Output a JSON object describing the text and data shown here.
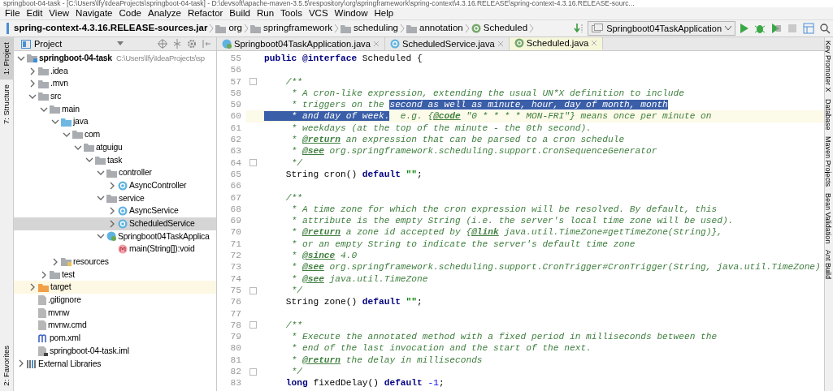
{
  "window": {
    "title": "springboot-04-task - [C:\\Users\\lfy\\IdeaProjects\\springboot-04-task] - D:\\devsoft\\apache-maven-3.5.5\\respository\\org\\springframework\\spring-context\\4.3.16.RELEASE\\spring-context-4.3.16.RELEASE-sourc..."
  },
  "menu": [
    "File",
    "Edit",
    "View",
    "Navigate",
    "Code",
    "Analyze",
    "Refactor",
    "Build",
    "Run",
    "Tools",
    "VCS",
    "Window",
    "Help"
  ],
  "breadcrumbs": [
    {
      "label": "spring-context-4.3.16.RELEASE-sources.jar",
      "kind": "jar"
    },
    {
      "label": "org",
      "kind": "folder"
    },
    {
      "label": "springframework",
      "kind": "folder"
    },
    {
      "label": "scheduling",
      "kind": "folder"
    },
    {
      "label": "annotation",
      "kind": "folder"
    },
    {
      "label": "Scheduled",
      "kind": "annotation"
    }
  ],
  "run_config": "Springboot04TaskApplication",
  "left_tabs": [
    {
      "label": "1: Project",
      "selected": true
    },
    {
      "label": "7: Structure",
      "selected": false
    },
    {
      "label": "2: Favorites",
      "selected": false
    }
  ],
  "right_tabs": [
    "Key Promoter X",
    "Database",
    "Maven Projects",
    "Bean Validation",
    "Ant Build"
  ],
  "project_panel": {
    "title": "Project",
    "tree": [
      {
        "label": "springboot-04-task",
        "hint": "C:\\Users\\lfy\\IdeaProjects\\sp",
        "kind": "project",
        "expanded": true,
        "selected": false,
        "children": [
          {
            "label": ".idea",
            "kind": "folder",
            "expanded": false,
            "selected": false
          },
          {
            "label": ".mvn",
            "kind": "folder",
            "expanded": false,
            "selected": false
          },
          {
            "label": "src",
            "kind": "folder",
            "expanded": true,
            "selected": false,
            "children": [
              {
                "label": "main",
                "kind": "folder",
                "expanded": true,
                "selected": false,
                "children": [
                  {
                    "label": "java",
                    "kind": "source-folder",
                    "expanded": true,
                    "selected": false,
                    "children": [
                      {
                        "label": "com",
                        "kind": "package",
                        "expanded": true,
                        "selected": false,
                        "children": [
                          {
                            "label": "atguigu",
                            "kind": "package",
                            "expanded": true,
                            "selected": false,
                            "children": [
                              {
                                "label": "task",
                                "kind": "package",
                                "expanded": true,
                                "selected": false,
                                "children": [
                                  {
                                    "label": "controller",
                                    "kind": "package",
                                    "expanded": true,
                                    "selected": false,
                                    "children": [
                                      {
                                        "label": "AsyncController",
                                        "kind": "class",
                                        "expanded": false,
                                        "selected": false
                                      }
                                    ]
                                  },
                                  {
                                    "label": "service",
                                    "kind": "package",
                                    "expanded": true,
                                    "selected": false,
                                    "children": [
                                      {
                                        "label": "AsyncService",
                                        "kind": "class",
                                        "expanded": false,
                                        "selected": false
                                      },
                                      {
                                        "label": "ScheduledService",
                                        "kind": "class",
                                        "expanded": false,
                                        "selected": true
                                      }
                                    ]
                                  },
                                  {
                                    "label": "Springboot04TaskApplica",
                                    "kind": "spring-class",
                                    "expanded": true,
                                    "selected": false,
                                    "children": [
                                      {
                                        "label": "main(String[]):void",
                                        "kind": "method",
                                        "selected": false
                                      }
                                    ]
                                  }
                                ]
                              }
                            ]
                          }
                        ]
                      }
                    ]
                  },
                  {
                    "label": "resources",
                    "kind": "resources-folder",
                    "expanded": false,
                    "selected": false
                  }
                ]
              },
              {
                "label": "test",
                "kind": "folder",
                "expanded": false,
                "selected": false
              }
            ]
          },
          {
            "label": "target",
            "kind": "excluded-folder",
            "expanded": false,
            "selected": false
          },
          {
            "label": ".gitignore",
            "kind": "file",
            "selected": false
          },
          {
            "label": "mvnw",
            "kind": "file",
            "selected": false
          },
          {
            "label": "mvnw.cmd",
            "kind": "file",
            "selected": false
          },
          {
            "label": "pom.xml",
            "kind": "maven",
            "selected": false
          },
          {
            "label": "springboot-04-task.iml",
            "kind": "iml",
            "selected": false
          }
        ]
      },
      {
        "label": "External Libraries",
        "kind": "libraries",
        "expanded": false,
        "selected": false
      }
    ]
  },
  "editor_tabs": [
    {
      "label": "Springboot04TaskApplication.java",
      "kind": "spring-class",
      "selected": false
    },
    {
      "label": "ScheduledService.java",
      "kind": "class",
      "selected": false
    },
    {
      "label": "Scheduled.java",
      "kind": "annotation",
      "selected": true
    }
  ],
  "code": [
    {
      "n": "55",
      "segments": [
        {
          "text": "public @interface",
          "kind": "keyword"
        },
        {
          "text": " Scheduled {",
          "kind": "plain"
        }
      ]
    },
    {
      "n": "56"
    },
    {
      "n": "57",
      "fold": true,
      "segments": [
        {
          "text": "    /**",
          "kind": "comment"
        }
      ]
    },
    {
      "n": "58",
      "segments": [
        {
          "text": "     * A cron-like expression, extending the usual UN*X definition to include",
          "kind": "comment"
        }
      ]
    },
    {
      "n": "59",
      "segments": [
        {
          "text": "     * triggers on the ",
          "kind": "comment",
          "selected": false
        },
        {
          "text": "second as well as minute, hour, day of month, month",
          "kind": "comment",
          "selected": true
        }
      ]
    },
    {
      "n": "60",
      "current": true,
      "segments": [
        {
          "text": "     * and day of week.",
          "kind": "comment",
          "selected": true
        },
        {
          "text": "  e.g. {",
          "kind": "comment",
          "selected": false
        },
        {
          "text": "@code",
          "kind": "doctag",
          "selected": false
        },
        {
          "text": " \"0 * * * * MON-FRI\"} means once per minute on",
          "kind": "comment",
          "selected": false
        }
      ]
    },
    {
      "n": "61",
      "segments": [
        {
          "text": "     * weekdays (at the top of the minute - the 0th second).",
          "kind": "comment"
        }
      ]
    },
    {
      "n": "62",
      "segments": [
        {
          "text": "     * ",
          "kind": "comment"
        },
        {
          "text": "@return",
          "kind": "doctag"
        },
        {
          "text": " an expression that can be parsed to a cron schedule",
          "kind": "comment"
        }
      ]
    },
    {
      "n": "63",
      "segments": [
        {
          "text": "     * ",
          "kind": "comment"
        },
        {
          "text": "@see",
          "kind": "doctag"
        },
        {
          "text": " org.springframework.scheduling.support.CronSequenceGenerator",
          "kind": "comment"
        }
      ]
    },
    {
      "n": "64",
      "fold": true,
      "segments": [
        {
          "text": "     */",
          "kind": "comment"
        }
      ]
    },
    {
      "n": "65",
      "segments": [
        {
          "text": "    String cron() ",
          "kind": "plain"
        },
        {
          "text": "default",
          "kind": "keyword"
        },
        {
          "text": " \"\"",
          "kind": "string"
        },
        {
          "text": ";",
          "kind": "plain"
        }
      ]
    },
    {
      "n": "66"
    },
    {
      "n": "67",
      "segments": [
        {
          "text": "    /**",
          "kind": "comment"
        }
      ]
    },
    {
      "n": "68",
      "segments": [
        {
          "text": "     * A time zone for which the cron expression will be resolved. By default, this",
          "kind": "comment"
        }
      ]
    },
    {
      "n": "69",
      "segments": [
        {
          "text": "     * attribute is the empty String (i.e. the server's local time zone will be used).",
          "kind": "comment"
        }
      ]
    },
    {
      "n": "70",
      "segments": [
        {
          "text": "     * ",
          "kind": "comment"
        },
        {
          "text": "@return",
          "kind": "doctag"
        },
        {
          "text": " a zone id accepted by {",
          "kind": "comment"
        },
        {
          "text": "@link",
          "kind": "doctag"
        },
        {
          "text": " java.util.TimeZone#getTimeZone(String)},",
          "kind": "comment"
        }
      ]
    },
    {
      "n": "71",
      "segments": [
        {
          "text": "     * or an empty String to indicate the server's default time zone",
          "kind": "comment"
        }
      ]
    },
    {
      "n": "72",
      "segments": [
        {
          "text": "     * ",
          "kind": "comment"
        },
        {
          "text": "@since",
          "kind": "doctag"
        },
        {
          "text": " 4.0",
          "kind": "comment"
        }
      ]
    },
    {
      "n": "73",
      "segments": [
        {
          "text": "     * ",
          "kind": "comment"
        },
        {
          "text": "@see",
          "kind": "doctag"
        },
        {
          "text": " org.springframework.scheduling.support.CronTrigger#CronTrigger(String, java.util.TimeZone)",
          "kind": "comment"
        }
      ]
    },
    {
      "n": "74",
      "segments": [
        {
          "text": "     * ",
          "kind": "comment"
        },
        {
          "text": "@see",
          "kind": "doctag"
        },
        {
          "text": " java.util.TimeZone",
          "kind": "comment"
        }
      ]
    },
    {
      "n": "75",
      "fold": true,
      "segments": [
        {
          "text": "     */",
          "kind": "comment"
        }
      ]
    },
    {
      "n": "76",
      "segments": [
        {
          "text": "    String zone() ",
          "kind": "plain"
        },
        {
          "text": "default",
          "kind": "keyword"
        },
        {
          "text": " \"\"",
          "kind": "string"
        },
        {
          "text": ";",
          "kind": "plain"
        }
      ]
    },
    {
      "n": "77"
    },
    {
      "n": "78",
      "fold": true,
      "segments": [
        {
          "text": "    /**",
          "kind": "comment"
        }
      ]
    },
    {
      "n": "79",
      "segments": [
        {
          "text": "     * Execute the annotated method with a fixed period in milliseconds between the",
          "kind": "comment"
        }
      ]
    },
    {
      "n": "80",
      "segments": [
        {
          "text": "     * end of the last invocation and the start of the next.",
          "kind": "comment"
        }
      ]
    },
    {
      "n": "81",
      "segments": [
        {
          "text": "     * ",
          "kind": "comment"
        },
        {
          "text": "@return",
          "kind": "doctag"
        },
        {
          "text": " the delay in milliseconds",
          "kind": "comment"
        }
      ]
    },
    {
      "n": "82",
      "fold": true,
      "segments": [
        {
          "text": "     */",
          "kind": "comment"
        }
      ]
    },
    {
      "n": "83",
      "segments": [
        {
          "text": "    long",
          "kind": "keyword"
        },
        {
          "text": " fixedDelay() ",
          "kind": "plain"
        },
        {
          "text": "default",
          "kind": "keyword"
        },
        {
          "text": " -1",
          "kind": "number"
        },
        {
          "text": ";",
          "kind": "plain"
        }
      ]
    }
  ]
}
